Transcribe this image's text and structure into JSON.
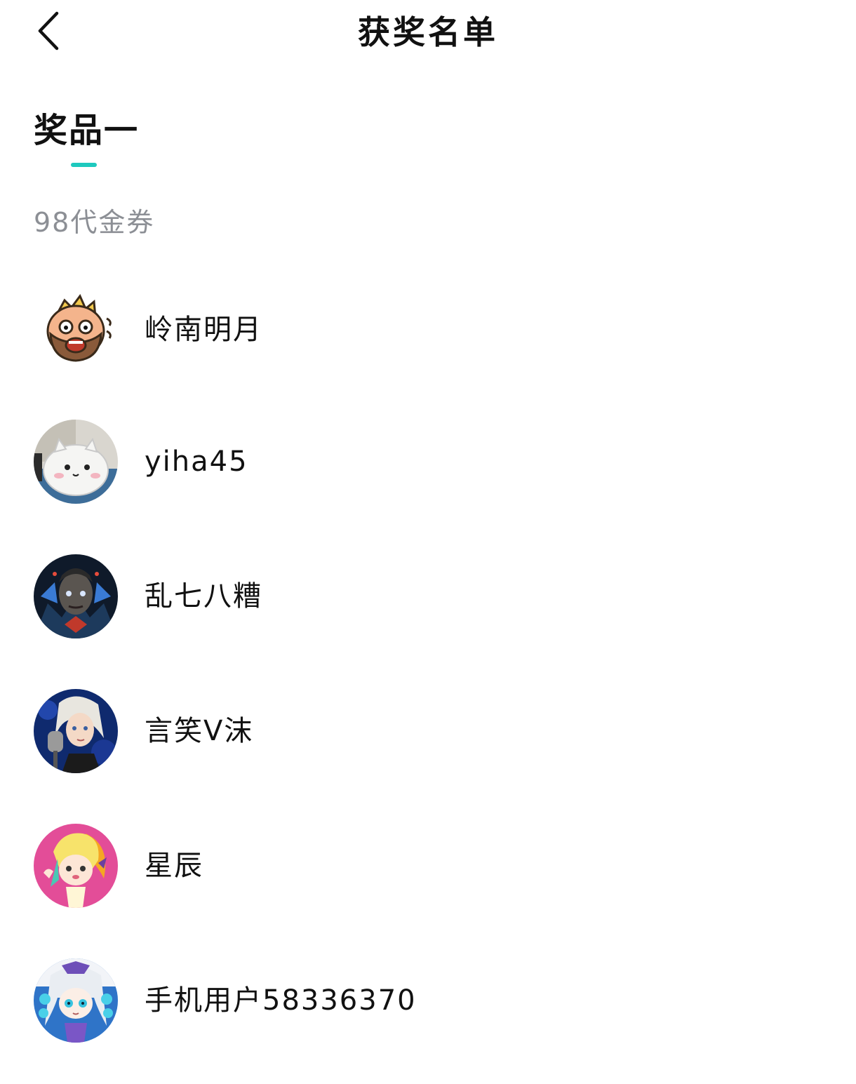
{
  "header": {
    "title": "获奖名单",
    "back_icon": "chevron-left-icon"
  },
  "tabs": [
    {
      "label": "奖品一",
      "active": true
    }
  ],
  "accent_color": "#1ec9be",
  "prize": {
    "name": "98代金券"
  },
  "winners": [
    {
      "name": "岭南明月",
      "avatar": "angry-bearded-cartoon-avatar"
    },
    {
      "name": "yiha45",
      "avatar": "white-plush-toy-avatar"
    },
    {
      "name": "乱七八糟",
      "avatar": "armored-game-character-avatar"
    },
    {
      "name": "言笑V沫",
      "avatar": "silver-hair-singer-avatar"
    },
    {
      "name": "星辰",
      "avatar": "blonde-anime-girl-pink-avatar"
    },
    {
      "name": "手机用户58336370",
      "avatar": "white-hair-anime-girl-avatar"
    }
  ]
}
